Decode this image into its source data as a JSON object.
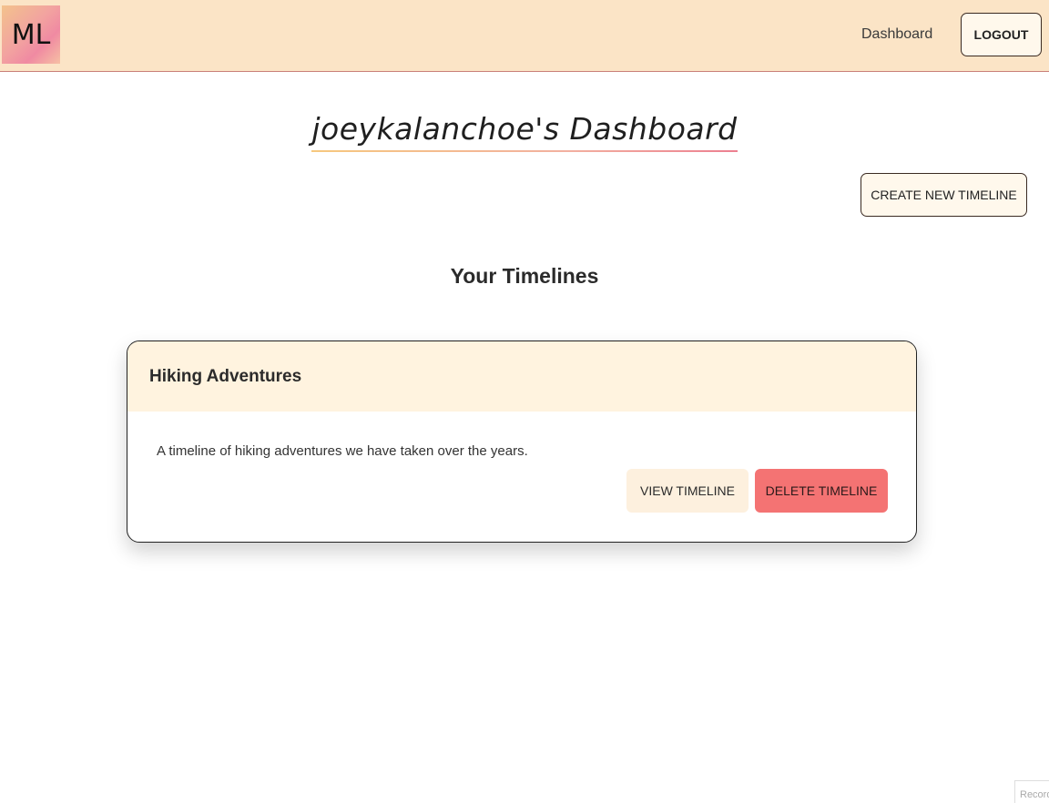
{
  "navbar": {
    "logo_text": "ML",
    "dashboard_link": "Dashboard",
    "logout_label": "LOGOUT"
  },
  "page": {
    "title": "joeykalanchoe's Dashboard",
    "create_button": "CREATE NEW TIMELINE",
    "section_heading": "Your Timelines"
  },
  "timelines": [
    {
      "title": "Hiking Adventures",
      "description": "A timeline of hiking adventures we have taken over the years.",
      "view_label": "VIEW TIMELINE",
      "delete_label": "DELETE TIMELINE"
    }
  ],
  "corner_widget": {
    "text": "Record"
  },
  "colors": {
    "navbar_bg": "#fbe4c6",
    "card_header_bg": "#fff3df",
    "delete_button": "#f47373",
    "view_button": "#fdf0de"
  }
}
